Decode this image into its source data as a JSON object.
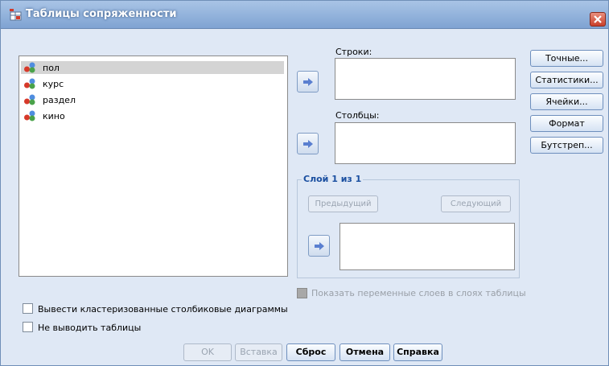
{
  "window": {
    "title": "Таблицы сопряженности"
  },
  "variables": [
    {
      "label": "пол",
      "selected": true
    },
    {
      "label": "курс",
      "selected": false
    },
    {
      "label": "раздел",
      "selected": false
    },
    {
      "label": "кино",
      "selected": false
    }
  ],
  "rows": {
    "label": "Строки:"
  },
  "columns": {
    "label": "Столбцы:"
  },
  "layer": {
    "legend": "Слой 1 из 1",
    "prev_label": "Предыдущий",
    "next_label": "Следующий"
  },
  "side_buttons": [
    "Точные...",
    "Статистики...",
    "Ячейки...",
    "Формат",
    "Бутстреп..."
  ],
  "options": {
    "show_layer_vars": "Показать переменные слоев в слоях таблицы",
    "clustered_bars": "Вывести кластеризованные столбиковые диаграммы",
    "suppress_tables": "Не выводить таблицы"
  },
  "footer": {
    "ok": "OK",
    "paste": "Вставка",
    "reset": "Сброс",
    "cancel": "Отмена",
    "help": "Справка"
  },
  "colors": {
    "title_bar": "#8fb0dc",
    "dialog_bg": "#dfe8f5",
    "arrow": "#5a7fd0"
  }
}
